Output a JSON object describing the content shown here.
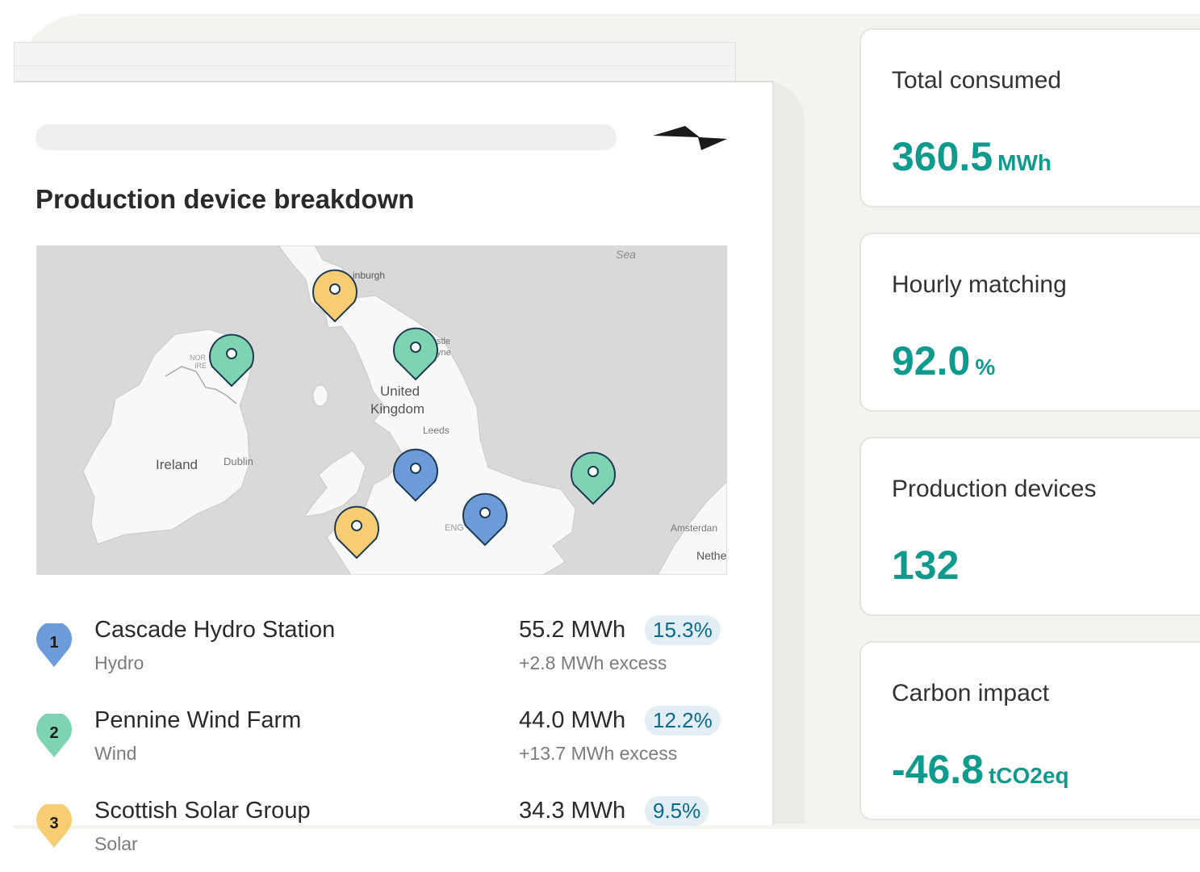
{
  "section": {
    "title": "Production device breakdown"
  },
  "map": {
    "place_labels": {
      "sea": "Sea",
      "edinburgh": "inburgh",
      "newcastle_1": "stle",
      "newcastle_2": "yne",
      "uk_1": "United",
      "uk_2": "Kingdom",
      "leeds": "Leeds",
      "ireland": "Ireland",
      "dublin": "Dublin",
      "ni_1": "NOR",
      "ni_2": "IRE",
      "england": "ENG",
      "amsterdam": "Amsterdan",
      "netherlands": "Nethe"
    },
    "pins": [
      {
        "type": "solar"
      },
      {
        "type": "wind"
      },
      {
        "type": "wind"
      },
      {
        "type": "hydro"
      },
      {
        "type": "wind"
      },
      {
        "type": "hydro"
      },
      {
        "type": "solar"
      }
    ]
  },
  "devices": [
    {
      "index": "1",
      "name": "Cascade Hydro Station",
      "type": "Hydro",
      "energy": "55.2 MWh",
      "percent": "15.3%",
      "excess": "+2.8 MWh excess",
      "color": "#6b9bd8"
    },
    {
      "index": "2",
      "name": "Pennine Wind Farm",
      "type": "Wind",
      "energy": "44.0 MWh",
      "percent": "12.2%",
      "excess": "+13.7 MWh excess",
      "color": "#7ed3b2"
    },
    {
      "index": "3",
      "name": "Scottish Solar Group",
      "type": "Solar",
      "energy": "34.3 MWh",
      "percent": "9.5%",
      "excess": "",
      "color": "#f7cd73"
    }
  ],
  "stats": [
    {
      "label": "Total consumed",
      "value": "360.5",
      "unit": "MWh"
    },
    {
      "label": "Hourly matching",
      "value": "92.0",
      "unit": "%"
    },
    {
      "label": "Production devices",
      "value": "132",
      "unit": ""
    },
    {
      "label": "Carbon impact",
      "value": "-46.8",
      "unit": "tCO2eq"
    }
  ],
  "colors": {
    "accent": "#0f9a8e",
    "hydro": "#6b9bd8",
    "wind": "#7ed3b2",
    "solar": "#f7cd73",
    "badge_bg": "#e3eef4",
    "badge_text": "#0d6a8f"
  }
}
